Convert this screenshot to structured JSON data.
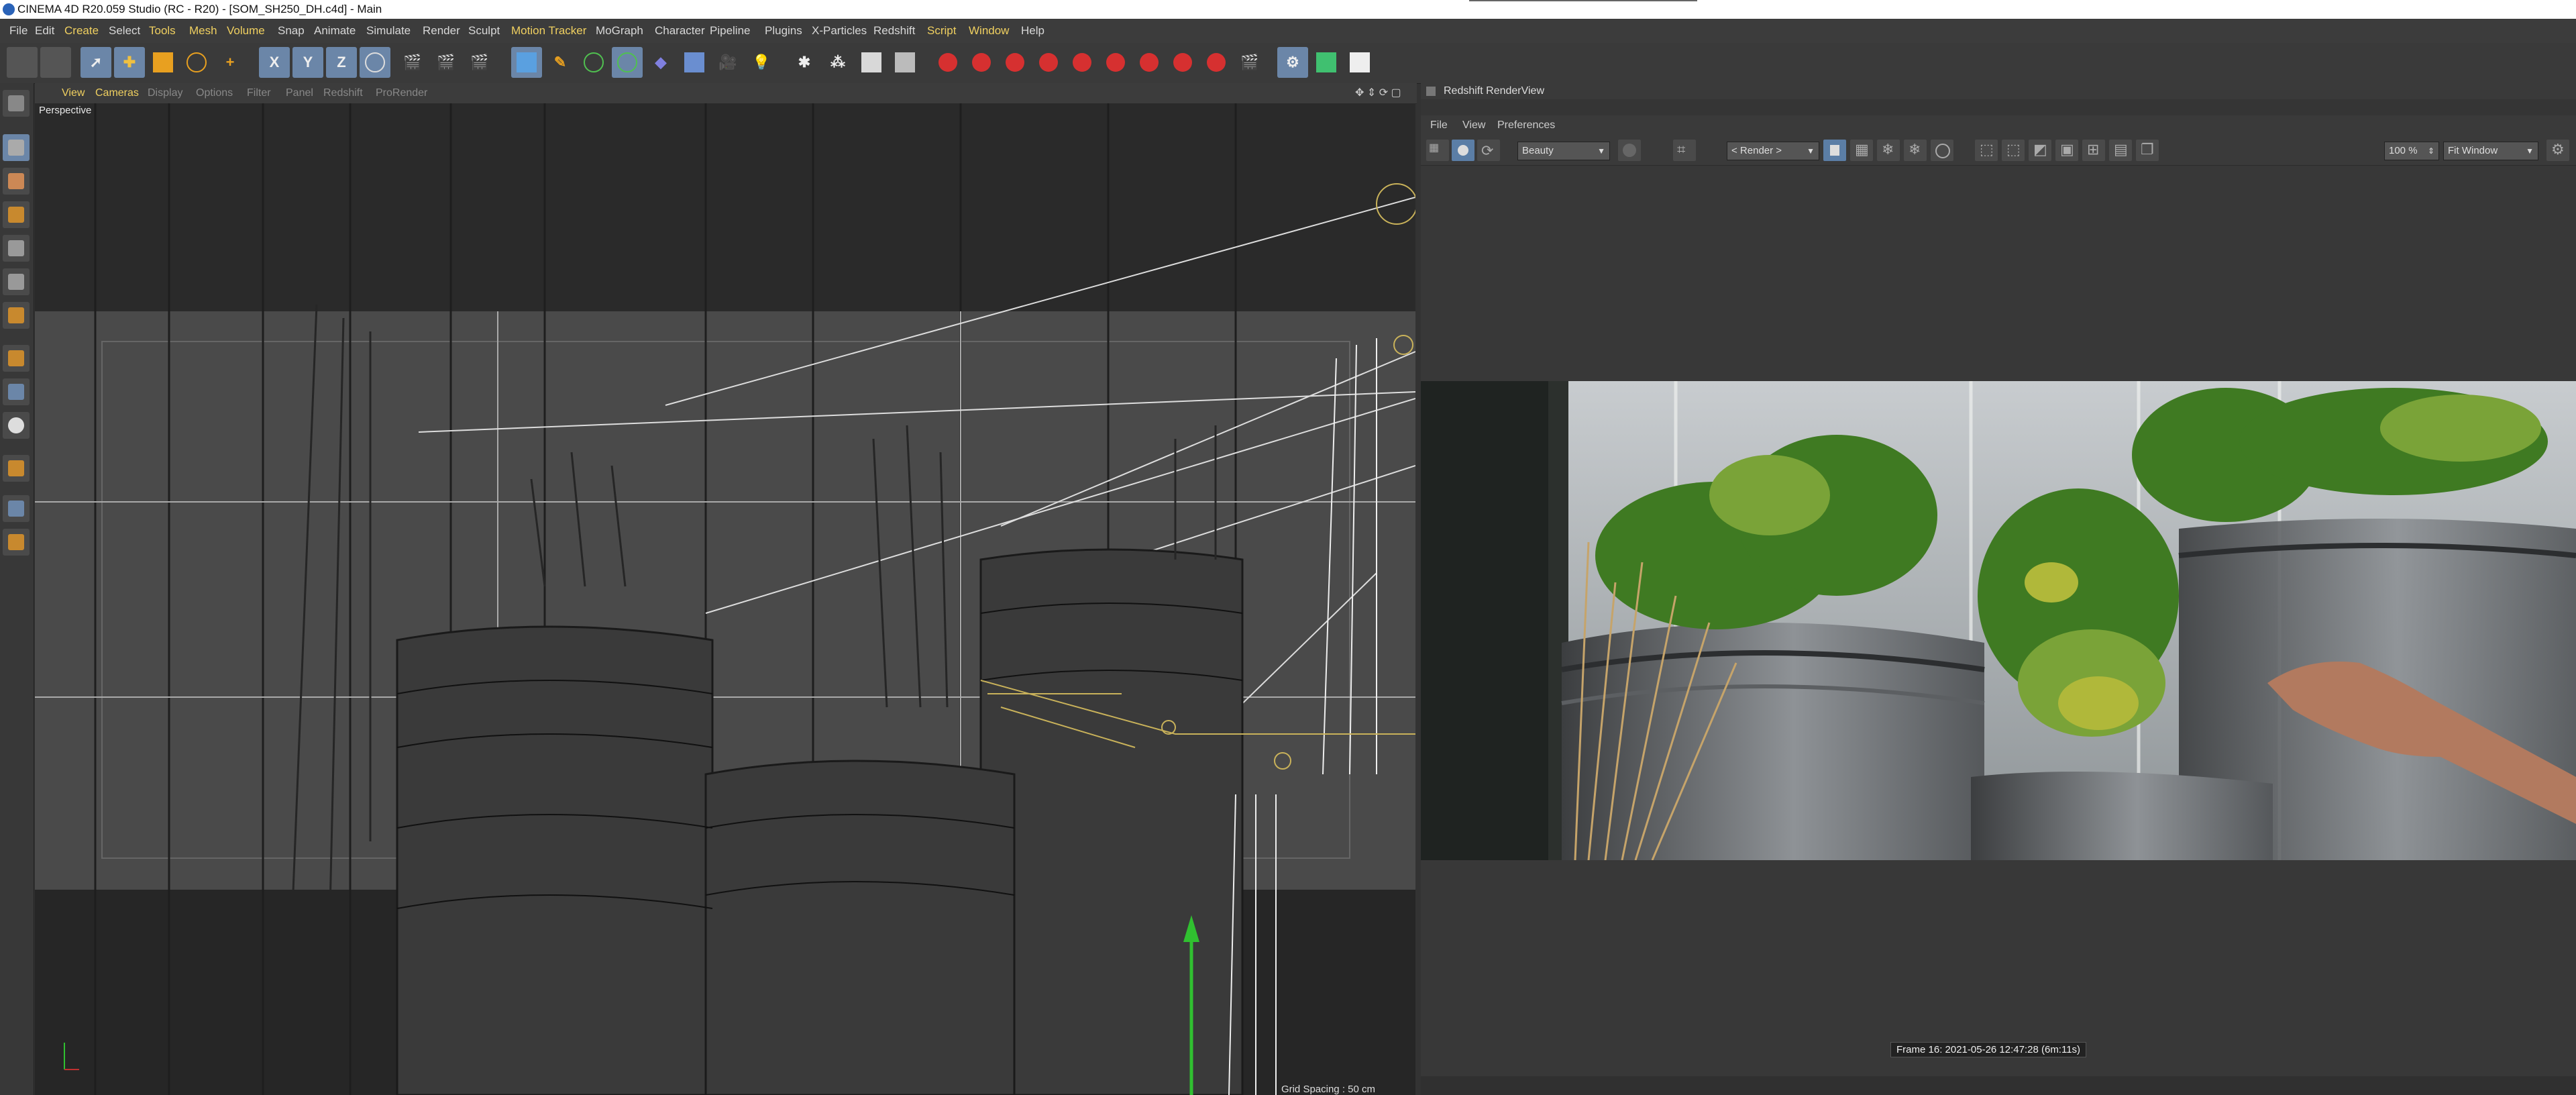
{
  "window": {
    "title": "CINEMA 4D R20.059 Studio (RC - R20) - [SOM_SH250_DH.c4d] - Main"
  },
  "menu": [
    "File",
    "Edit",
    "Create",
    "Select",
    "Tools",
    "Mesh",
    "Volume",
    "Snap",
    "Animate",
    "Simulate",
    "Render",
    "Sculpt",
    "Motion Tracker",
    "MoGraph",
    "Character",
    "Pipeline",
    "Plugins",
    "X-Particles",
    "Redshift",
    "Script",
    "Window",
    "Help"
  ],
  "viewport": {
    "menu": [
      "View",
      "Cameras",
      "Display",
      "Options",
      "Filter",
      "Panel",
      "Redshift",
      "ProRender"
    ],
    "label": "Perspective",
    "grid_spacing": "Grid Spacing : 50 cm"
  },
  "renderview": {
    "title": "Redshift RenderView",
    "menu": [
      "File",
      "View",
      "Preferences"
    ],
    "aov": "Beauty",
    "camera": "< Render >",
    "zoom": "100 %",
    "fit": "Fit Window",
    "frame_info": "Frame 16: 2021-05-26 12:47:28 (6m:11s)"
  }
}
